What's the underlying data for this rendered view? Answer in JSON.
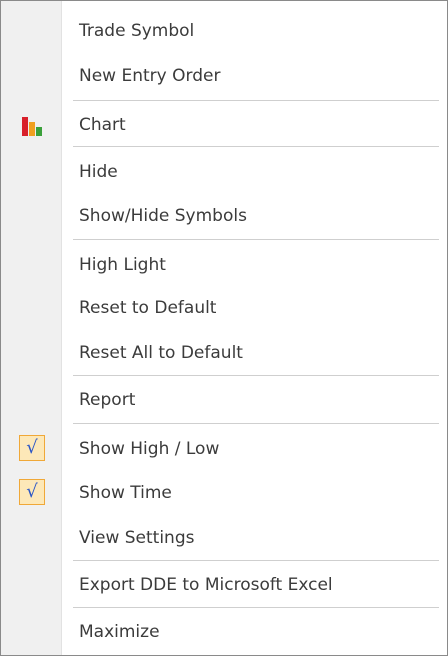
{
  "menu": {
    "items": [
      {
        "label": "Trade Symbol"
      },
      {
        "label": "New Entry Order"
      },
      {
        "label": "Chart",
        "icon": "bar-chart-icon"
      },
      {
        "label": "Hide"
      },
      {
        "label": "Show/Hide Symbols"
      },
      {
        "label": "High Light"
      },
      {
        "label": "Reset to Default"
      },
      {
        "label": "Reset All to Default"
      },
      {
        "label": "Report"
      },
      {
        "label": "Show High / Low",
        "checked": true
      },
      {
        "label": "Show Time",
        "checked": true
      },
      {
        "label": "View Settings"
      },
      {
        "label": "Export DDE to Microsoft Excel"
      },
      {
        "label": "Maximize"
      }
    ],
    "check_glyph": "√"
  },
  "colors": {
    "gutter": "#f0f0f0",
    "separator": "#cfcfcf",
    "check_background": "#fde8b8",
    "check_border": "#f0a838",
    "check_mark": "#2a55c6",
    "chart_icon_bars": [
      "#d8202a",
      "#f0a020",
      "#3aa03a"
    ]
  }
}
